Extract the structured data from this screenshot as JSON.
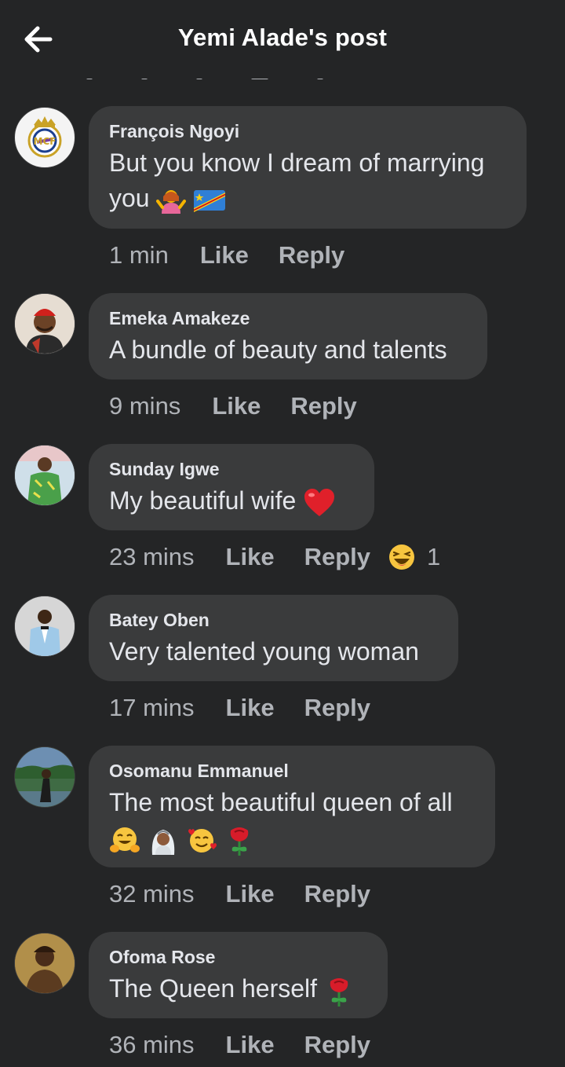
{
  "header": {
    "title": "Yemi Alade's post",
    "back_icon": "back-arrow-icon"
  },
  "comments": [
    {
      "name": "François Ngoyi",
      "text": "But you know I dream of marrying",
      "text2": "you",
      "time": "1 min",
      "like": "Like",
      "reply": "Reply",
      "avatar": "real-madrid-crest"
    },
    {
      "name": "Emeka Amakeze",
      "text": "A bundle of beauty and talents",
      "time": "9 mins",
      "like": "Like",
      "reply": "Reply",
      "avatar": "person-red-cap"
    },
    {
      "name": "Sunday Igwe",
      "text": "My beautiful wife",
      "time": "23 mins",
      "like": "Like",
      "reply": "Reply",
      "reaction_count": "1",
      "avatar": "person-green-outfit"
    },
    {
      "name": "Batey Oben",
      "text": "Very talented young woman",
      "time": "17 mins",
      "like": "Like",
      "reply": "Reply",
      "avatar": "person-light-suit"
    },
    {
      "name": "Osomanu Emmanuel",
      "text": "The most beautiful queen of all",
      "time": "32 mins",
      "like": "Like",
      "reply": "Reply",
      "avatar": "person-outdoor"
    },
    {
      "name": "Ofoma Rose",
      "text": "The Queen herself",
      "time": "36 mins",
      "like": "Like",
      "reply": "Reply",
      "avatar": "person-gold-bg"
    }
  ],
  "colors": {
    "background": "#242526",
    "bubble": "#3a3b3c",
    "meta": "#b0b3b8",
    "text": "#e4e6eb"
  }
}
